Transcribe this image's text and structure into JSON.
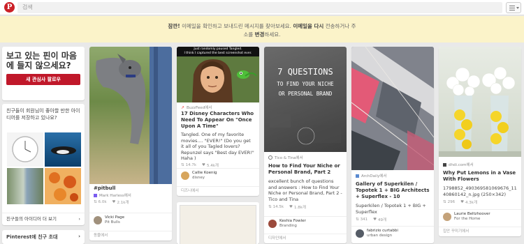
{
  "header": {
    "logo": "P",
    "search_placeholder": "검색"
  },
  "notice": {
    "bold1": "잠깐!",
    "text1": " 이메일을 확인하고 보내드린 메시지를 찾아보세요. ",
    "bold2": "이메일을 다시",
    "text2": " 전송하거나 주",
    "line2a": "소를 ",
    "bold3": "변경",
    "line2b": "하세요."
  },
  "promo": {
    "title": "보고 있는 핀이 마음에 들지 않으세요?",
    "button": "새 관심사 팔로우"
  },
  "friends": {
    "title": "친구들이 회원님이 좋아할 만한 아이디어를 저장하고 있나요?",
    "footer": "친구들의 아이디어 더 보기"
  },
  "invite": {
    "label": "Pinterest에 친구 초대"
  },
  "pins": [
    {
      "title": "#pitbull",
      "source": "Mark Harless에서",
      "saves": "6.0k",
      "likes": "2.1k개",
      "user": "Vicki Page",
      "board": "Pit Bulls",
      "footer": "동물에서"
    },
    {
      "banner1": "Just randomly paused Tangled.",
      "banner2": "I think I captured the best screenshot ever.",
      "source": "BuzzFeed에서",
      "title": "17 Disney Characters Who Need To Appear On \"Once Upon A Time\"",
      "desc": "Tangled. One of my favorite movies.... \"EVER!\" (Do you get it all of you Tagled lovers? Repunzel says \"Best day EVER!\" Haha )",
      "saves": "14.7k",
      "likes": "5.4k개",
      "user": "Callie Koenig",
      "board": "disney",
      "footer": "디즈니에서"
    },
    {
      "overlay1": "7 QUESTIONS",
      "overlay2": "TO FIND YOUR NICHE",
      "overlay3": "OR PERSONAL BRAND",
      "source": "Tico & Tina에서",
      "title": "How to Find Your Niche or Personal Brand, Part 2",
      "desc": "excellent bunch of questions and answers : How to Find Your Niche or Personal Brand, Part 2 - Tico and Tina",
      "saves": "14.5k",
      "likes": "1.8k개",
      "user": "Keshia Fowler",
      "board": "Branding",
      "footer": "디자인에서"
    },
    {
      "source": "ArchDaily에서",
      "title": "Gallery of Superkilen / Topotek 1 + BIG Architects + Superflex - 10",
      "desc": "Superkilen / Topotek 1 + BIG + Superflex",
      "saves": "341",
      "likes": "49개",
      "user": "fabrizio curtabbi",
      "board": "urban design",
      "footer": ""
    },
    {
      "source": "dhdi.com에서",
      "title": "Why Put Lemons in a Vase With Flowers",
      "desc": "1798852_490369581069676_1140860142_n.jpg (250×342)",
      "saves": "296",
      "likes": "4.3k개",
      "user": "Laurie Beltzhoover",
      "board": "For the Home",
      "footer": "집안 꾸미기에서"
    }
  ],
  "colors": {
    "brand": "#cb2027",
    "notice_bg": "#fbf3c9",
    "button": "#c0182a"
  }
}
